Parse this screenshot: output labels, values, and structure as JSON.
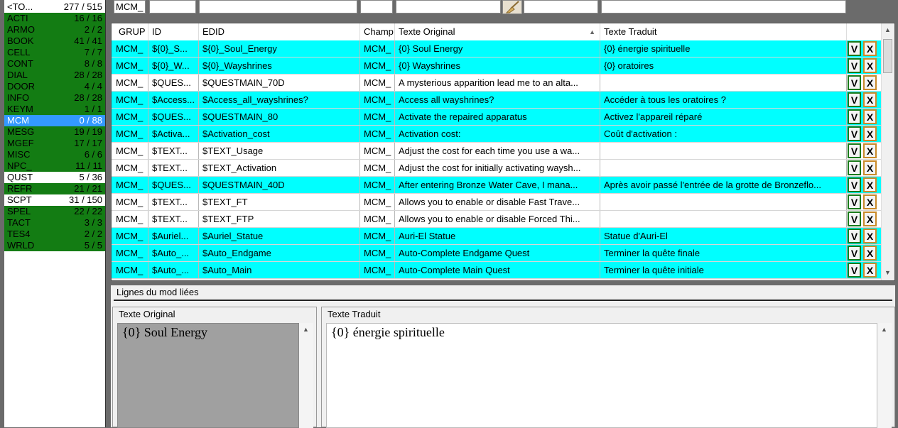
{
  "categories": [
    {
      "name": "<TO...",
      "count": "277 / 515",
      "style": "w"
    },
    {
      "name": "ACTI",
      "count": "16 / 16",
      "style": "g"
    },
    {
      "name": "ARMO",
      "count": "2 / 2",
      "style": "g"
    },
    {
      "name": "BOOK",
      "count": "41 / 41",
      "style": "g"
    },
    {
      "name": "CELL",
      "count": "7 / 7",
      "style": "g"
    },
    {
      "name": "CONT",
      "count": "8 / 8",
      "style": "g"
    },
    {
      "name": "DIAL",
      "count": "28 / 28",
      "style": "g"
    },
    {
      "name": "DOOR",
      "count": "4 / 4",
      "style": "g"
    },
    {
      "name": "INFO",
      "count": "28 / 28",
      "style": "g"
    },
    {
      "name": "KEYM",
      "count": "1 / 1",
      "style": "g"
    },
    {
      "name": "MCM",
      "count": "0 / 88",
      "style": "s"
    },
    {
      "name": "MESG",
      "count": "19 / 19",
      "style": "g"
    },
    {
      "name": "MGEF",
      "count": "17 / 17",
      "style": "g"
    },
    {
      "name": "MISC",
      "count": "6 / 6",
      "style": "g"
    },
    {
      "name": "NPC_",
      "count": "11 / 11",
      "style": "g"
    },
    {
      "name": "QUST",
      "count": "5 / 36",
      "style": "w"
    },
    {
      "name": "REFR",
      "count": "21 / 21",
      "style": "g"
    },
    {
      "name": "SCPT",
      "count": "31 / 150",
      "style": "w"
    },
    {
      "name": "SPEL",
      "count": "22 / 22",
      "style": "g"
    },
    {
      "name": "TACT",
      "count": "3 / 3",
      "style": "g"
    },
    {
      "name": "TES4",
      "count": "2 / 2",
      "style": "g"
    },
    {
      "name": "WRLD",
      "count": "5 / 5",
      "style": "g"
    }
  ],
  "filter": {
    "grup_value": "MCM_"
  },
  "columns": {
    "grup": "GRUP",
    "id": "ID",
    "edid": "EDID",
    "champ": "Champ",
    "orig": "Texte Original",
    "trad": "Texte Traduit"
  },
  "row_buttons": {
    "validate": "V",
    "reject": "X"
  },
  "rows": [
    {
      "grup": "MCM_",
      "id": "${0}_S...",
      "edid": "${0}_Soul_Energy",
      "champ": "MCM_",
      "orig": "{0} Soul Energy",
      "trad": "{0} énergie spirituelle",
      "style": "cy"
    },
    {
      "grup": "MCM_",
      "id": "${0}_W...",
      "edid": "${0}_Wayshrines",
      "champ": "MCM_",
      "orig": "{0} Wayshrines",
      "trad": "{0} oratoires",
      "style": "cy"
    },
    {
      "grup": "MCM_",
      "id": "$QUES...",
      "edid": "$QUESTMAIN_70D",
      "champ": "MCM_",
      "orig": "A mysterious apparition lead me to an alta...",
      "trad": "",
      "style": "wh"
    },
    {
      "grup": "MCM_",
      "id": "$Access...",
      "edid": "$Access_all_wayshrines?",
      "champ": "MCM_",
      "orig": "Access all wayshrines?",
      "trad": "Accéder à tous les oratoires ?",
      "style": "cy"
    },
    {
      "grup": "MCM_",
      "id": "$QUES...",
      "edid": "$QUESTMAIN_80",
      "champ": "MCM_",
      "orig": "Activate the repaired apparatus",
      "trad": "Activez l'appareil réparé",
      "style": "cy"
    },
    {
      "grup": "MCM_",
      "id": "$Activa...",
      "edid": "$Activation_cost",
      "champ": "MCM_",
      "orig": "Activation cost:",
      "trad": "Coût d'activation :",
      "style": "cy"
    },
    {
      "grup": "MCM_",
      "id": "$TEXT...",
      "edid": "$TEXT_Usage",
      "champ": "MCM_",
      "orig": "Adjust the cost for each time you use a wa...",
      "trad": "",
      "style": "wh"
    },
    {
      "grup": "MCM_",
      "id": "$TEXT...",
      "edid": "$TEXT_Activation",
      "champ": "MCM_",
      "orig": "Adjust the cost for initially activating waysh...",
      "trad": "",
      "style": "wh"
    },
    {
      "grup": "MCM_",
      "id": "$QUES...",
      "edid": "$QUESTMAIN_40D",
      "champ": "MCM_",
      "orig": "After entering Bronze Water Cave, I mana...",
      "trad": "Après avoir passé l'entrée de la grotte de Bronzeflo...",
      "style": "cy"
    },
    {
      "grup": "MCM_",
      "id": "$TEXT...",
      "edid": "$TEXT_FT",
      "champ": "MCM_",
      "orig": "Allows you to enable or disable Fast Trave...",
      "trad": "",
      "style": "wh"
    },
    {
      "grup": "MCM_",
      "id": "$TEXT...",
      "edid": "$TEXT_FTP",
      "champ": "MCM_",
      "orig": "Allows you to enable or disable Forced Thi...",
      "trad": "",
      "style": "wh"
    },
    {
      "grup": "MCM_",
      "id": "$Auriel...",
      "edid": "$Auriel_Statue",
      "champ": "MCM_",
      "orig": "Auri-El Statue",
      "trad": "Statue d'Auri-El",
      "style": "cy"
    },
    {
      "grup": "MCM_",
      "id": "$Auto_...",
      "edid": "$Auto_Endgame",
      "champ": "MCM_",
      "orig": "Auto-Complete Endgame Quest",
      "trad": "Terminer la quête finale",
      "style": "cy"
    },
    {
      "grup": "MCM_",
      "id": "$Auto_...",
      "edid": "$Auto_Main",
      "champ": "MCM_",
      "orig": "Auto-Complete Main Quest",
      "trad": "Terminer la quête initiale",
      "style": "cy"
    }
  ],
  "linked": {
    "title": "Lignes du mod liées",
    "orig_label": "Texte Original",
    "trad_label": "Texte Traduit",
    "orig_text": "{0} Soul Energy",
    "trad_text": "{0} énergie spirituelle"
  },
  "colors": {
    "done": "#137c13",
    "selected": "#3399ff",
    "translated_row": "#00ffff"
  }
}
